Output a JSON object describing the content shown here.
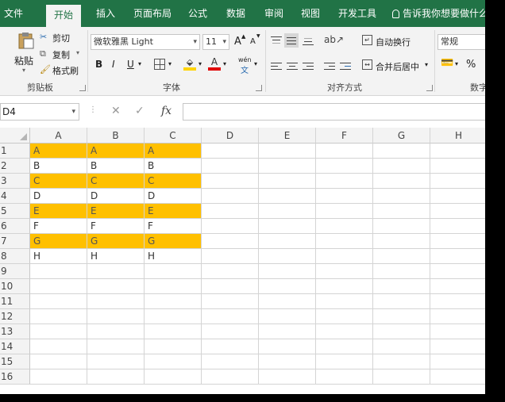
{
  "tabs": [
    {
      "label": "文件",
      "active": false
    },
    {
      "label": "开始",
      "active": true
    },
    {
      "label": "插入",
      "active": false
    },
    {
      "label": "页面布局",
      "active": false
    },
    {
      "label": "公式",
      "active": false
    },
    {
      "label": "数据",
      "active": false
    },
    {
      "label": "审阅",
      "active": false
    },
    {
      "label": "视图",
      "active": false
    },
    {
      "label": "开发工具",
      "active": false
    }
  ],
  "tell_me": "告诉我你想要做什么",
  "clipboard": {
    "paste": "粘贴",
    "cut": "剪切",
    "copy": "复制",
    "format_painter": "格式刷",
    "label": "剪贴板"
  },
  "font": {
    "name": "微软雅黑 Light",
    "size": "11",
    "increase": "A",
    "decrease": "A",
    "bold": "B",
    "italic": "I",
    "underline": "U",
    "phonetic": "wén",
    "label": "字体"
  },
  "alignment": {
    "wrap": "自动换行",
    "merge": "合并后居中",
    "label": "对齐方式"
  },
  "number": {
    "format": "常规",
    "percent": "%",
    "label": "数字"
  },
  "formula_bar": {
    "name_box": "D4",
    "value": ""
  },
  "columns": [
    "A",
    "B",
    "C",
    "D",
    "E",
    "F",
    "G",
    "H"
  ],
  "rows": [
    {
      "n": "1",
      "cells": [
        "A",
        "A",
        "A"
      ],
      "highlight": true
    },
    {
      "n": "2",
      "cells": [
        "B",
        "B",
        "B"
      ],
      "highlight": false
    },
    {
      "n": "3",
      "cells": [
        "C",
        "C",
        "C"
      ],
      "highlight": true
    },
    {
      "n": "4",
      "cells": [
        "D",
        "D",
        "D"
      ],
      "highlight": false
    },
    {
      "n": "5",
      "cells": [
        "E",
        "E",
        "E"
      ],
      "highlight": true
    },
    {
      "n": "6",
      "cells": [
        "F",
        "F",
        "F"
      ],
      "highlight": false
    },
    {
      "n": "7",
      "cells": [
        "G",
        "G",
        "G"
      ],
      "highlight": true
    },
    {
      "n": "8",
      "cells": [
        "H",
        "H",
        "H"
      ],
      "highlight": false
    },
    {
      "n": "9",
      "cells": [],
      "highlight": false
    },
    {
      "n": "10",
      "cells": [],
      "highlight": false
    },
    {
      "n": "11",
      "cells": [],
      "highlight": false
    },
    {
      "n": "12",
      "cells": [],
      "highlight": false
    },
    {
      "n": "13",
      "cells": [],
      "highlight": false
    },
    {
      "n": "14",
      "cells": [],
      "highlight": false
    },
    {
      "n": "15",
      "cells": [],
      "highlight": false
    },
    {
      "n": "16",
      "cells": [],
      "highlight": false
    }
  ],
  "colors": {
    "brand": "#217346",
    "highlight": "#ffc000",
    "font_color": "#e00000",
    "fill_color": "#ffd400"
  }
}
